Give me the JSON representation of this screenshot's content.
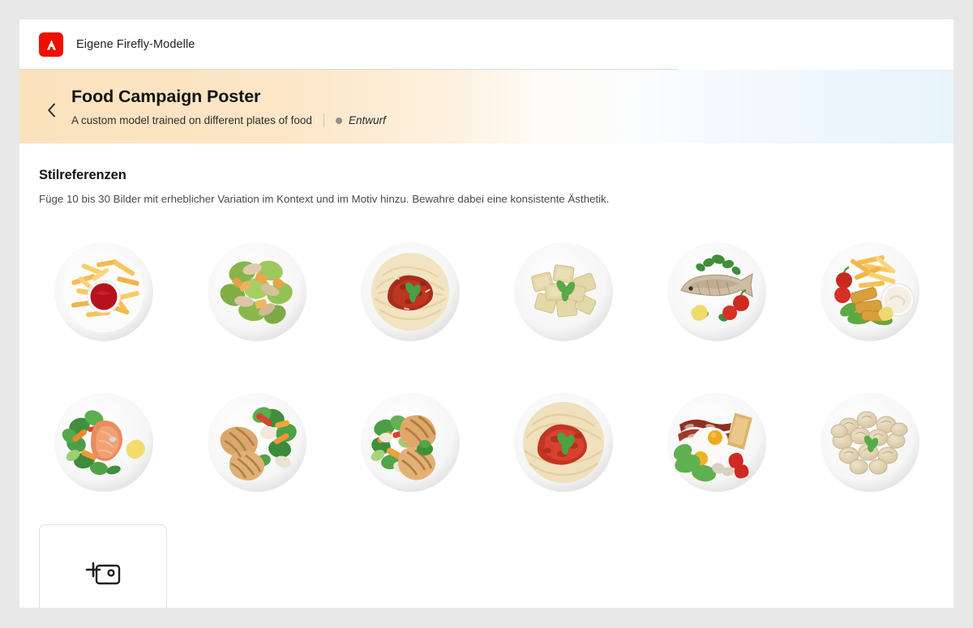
{
  "topbar": {
    "logo_icon": "adobe-logo-icon",
    "title": "Eigene Firefly-Modelle",
    "logo_color": "#eb1000"
  },
  "banner": {
    "back_icon": "chevron-left-icon",
    "title": "Food Campaign Poster",
    "description": "A custom model trained on different plates of food",
    "status": "Entwurf",
    "status_dot_color": "#8f8f8f",
    "gradient_start": "#fbe2bd",
    "gradient_end": "#e8f4fc"
  },
  "main": {
    "section_title": "Stilreferenzen",
    "section_description": "Füge 10 bis 30 Bilder mit erheblicher Variation im Kontext und im Motiv hinzu. Bewahre dabei eine konsistente Ästhetik.",
    "references": [
      {
        "id": "fries-ketchup",
        "alt": "Plate of french fries with ketchup dip"
      },
      {
        "id": "caesar-salad",
        "alt": "Plate of caesar salad with chicken and croutons"
      },
      {
        "id": "spaghetti-bolognese",
        "alt": "Plate of spaghetti with bolognese sauce and basil"
      },
      {
        "id": "ravioli",
        "alt": "Plate of ravioli with basil"
      },
      {
        "id": "grilled-fish",
        "alt": "Plate of grilled whole fish with tomatoes and parsley"
      },
      {
        "id": "fish-sticks-fries",
        "alt": "Plate of fish sticks with fries, tomatoes and mayo dip"
      },
      {
        "id": "salmon-steak",
        "alt": "Plate of salmon steak with mixed vegetables and lemon"
      },
      {
        "id": "grilled-chicken",
        "alt": "Plate of grilled chicken fillets with vegetables"
      },
      {
        "id": "grilled-meat-veg",
        "alt": "Plate of grilled meat with steamed vegetables"
      },
      {
        "id": "pasta-tomato",
        "alt": "Plate of pasta with tomato sauce and basil"
      },
      {
        "id": "english-breakfast",
        "alt": "Plate of english breakfast with bacon, fried eggs and toast"
      },
      {
        "id": "dumplings",
        "alt": "Plate of dumplings with parsley"
      }
    ],
    "upload_icon": "add-image-icon"
  }
}
